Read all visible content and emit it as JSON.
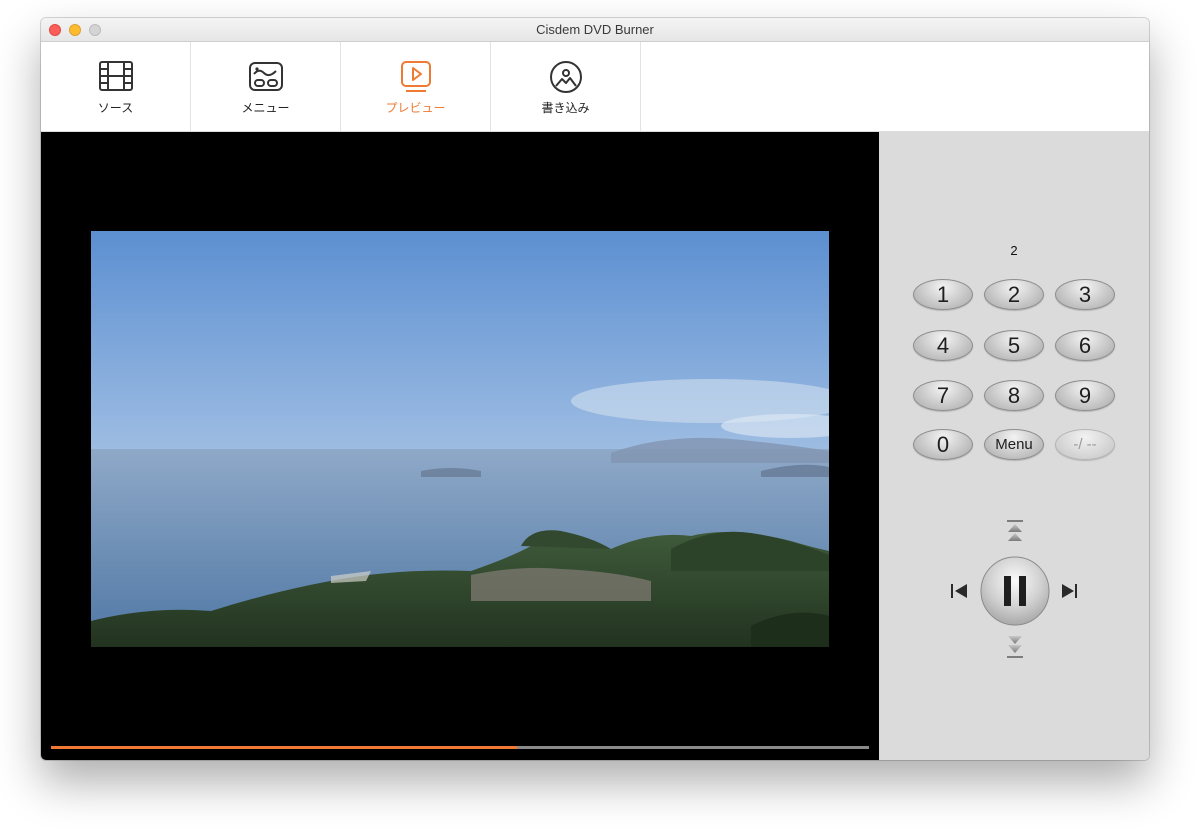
{
  "window": {
    "title": "Cisdem DVD Burner"
  },
  "toolbar": {
    "tabs": [
      {
        "label": "ソース",
        "icon": "film-icon"
      },
      {
        "label": "メニュー",
        "icon": "menu-layout-icon"
      },
      {
        "label": "プレビュー",
        "icon": "play-preview-icon"
      },
      {
        "label": "書き込み",
        "icon": "burn-disc-icon"
      }
    ],
    "active_tab": "プレビュー"
  },
  "colors": {
    "accent": "#ef7a34",
    "close": "#fc5f57",
    "minimize": "#fdbc2e",
    "maximize": "#d4d4d4",
    "remote_panel": "#dbdbdb",
    "stage": "#000000"
  },
  "player": {
    "progress_fraction": 0.57
  },
  "remote": {
    "display_number": "2",
    "keypad": [
      "1",
      "2",
      "3",
      "4",
      "5",
      "6",
      "7",
      "8",
      "9"
    ],
    "zero_label": "0",
    "menu_label": "Menu",
    "dash_label": "-/ --",
    "nav_icons": [
      "skip-up-icon",
      "previous-icon",
      "pause-icon",
      "next-icon",
      "skip-down-icon"
    ]
  }
}
